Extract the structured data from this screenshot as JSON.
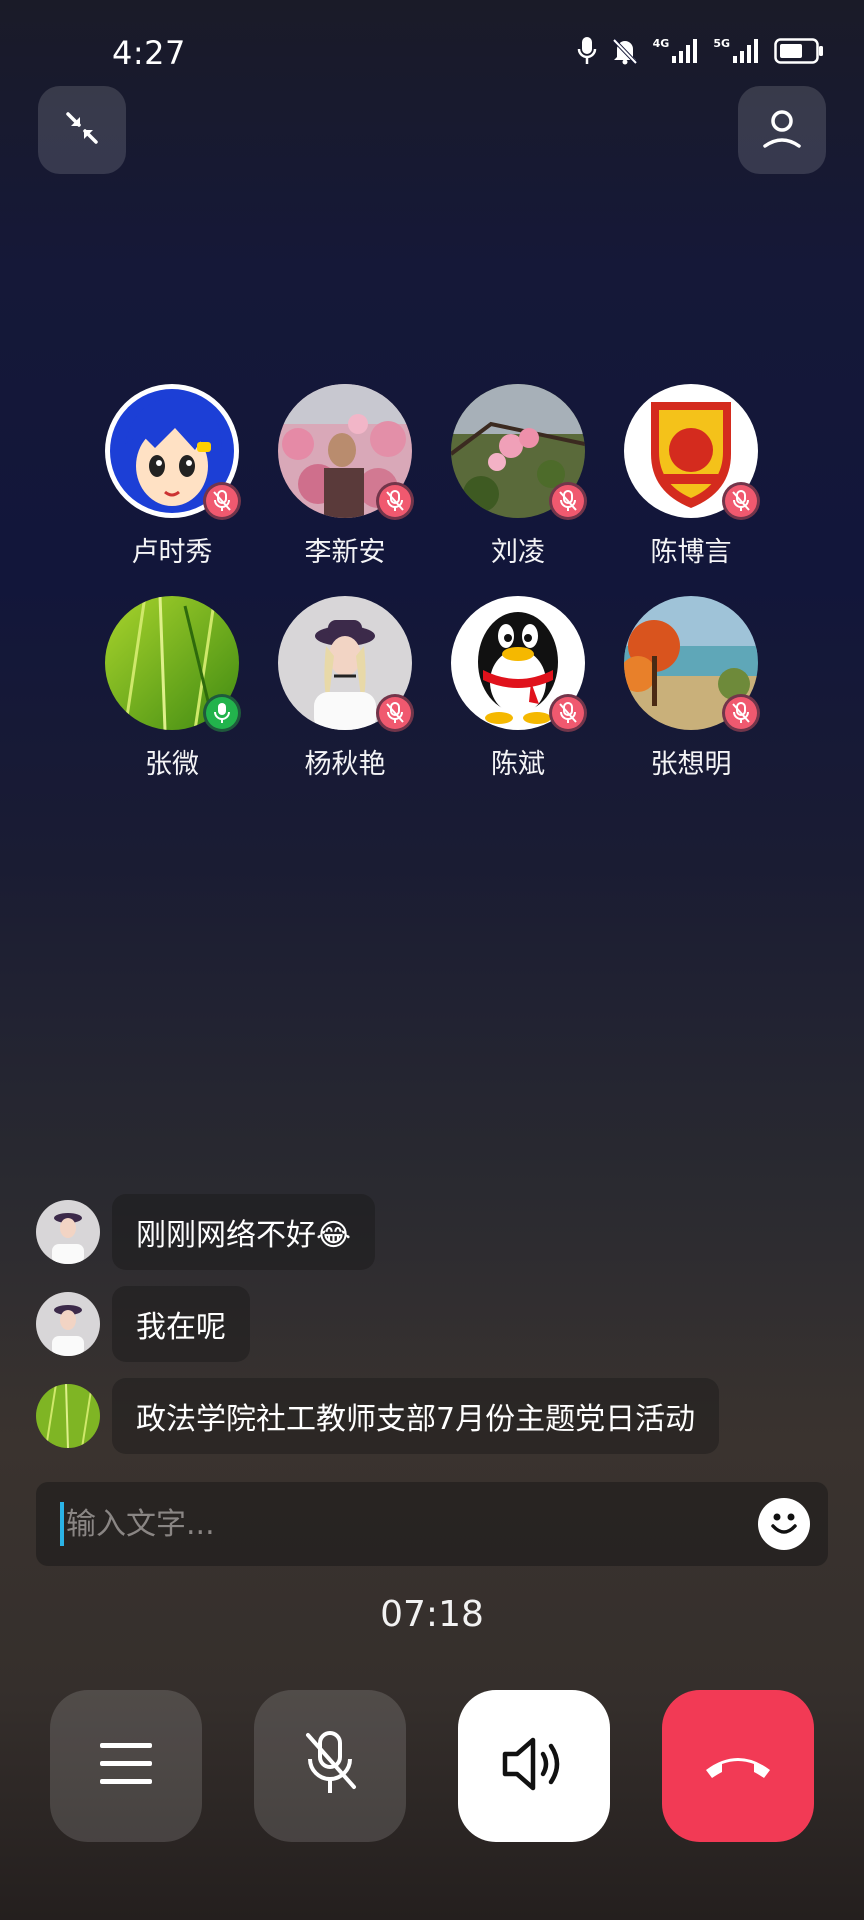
{
  "status_bar": {
    "time": "4:27",
    "icons": [
      "mic-icon",
      "bell-off-icon",
      "signal-4g-icon",
      "signal-5g-icon",
      "battery-icon"
    ],
    "net_4g": "4G",
    "net_5g": "5G"
  },
  "top_bar": {
    "minimize_icon": "minimize-arrows-icon",
    "profile_icon": "person-icon"
  },
  "participants": [
    {
      "name": "卢时秀",
      "mic": "muted"
    },
    {
      "name": "李新安",
      "mic": "muted"
    },
    {
      "name": "刘凌",
      "mic": "muted"
    },
    {
      "name": "陈博言",
      "mic": "muted"
    },
    {
      "name": "张微",
      "mic": "on"
    },
    {
      "name": "杨秋艳",
      "mic": "muted"
    },
    {
      "name": "陈斌",
      "mic": "muted"
    },
    {
      "name": "张想明",
      "mic": "muted"
    }
  ],
  "messages": [
    {
      "text": "刚刚网络不好😂"
    },
    {
      "text": "我在呢"
    },
    {
      "text": "政法学院社工教师支部7月份主题党日活动"
    }
  ],
  "input": {
    "placeholder": "输入文字...",
    "value": ""
  },
  "call_timer": "07:18",
  "controls": [
    {
      "icon": "menu-icon"
    },
    {
      "icon": "mic-off-icon"
    },
    {
      "icon": "speaker-icon"
    },
    {
      "icon": "hang-up-icon"
    }
  ],
  "colors": {
    "mute_badge": "#f0596f",
    "active_mic_badge": "#22b34c",
    "hang_up": "#f23a55",
    "input_caret": "#2bb3e6"
  }
}
